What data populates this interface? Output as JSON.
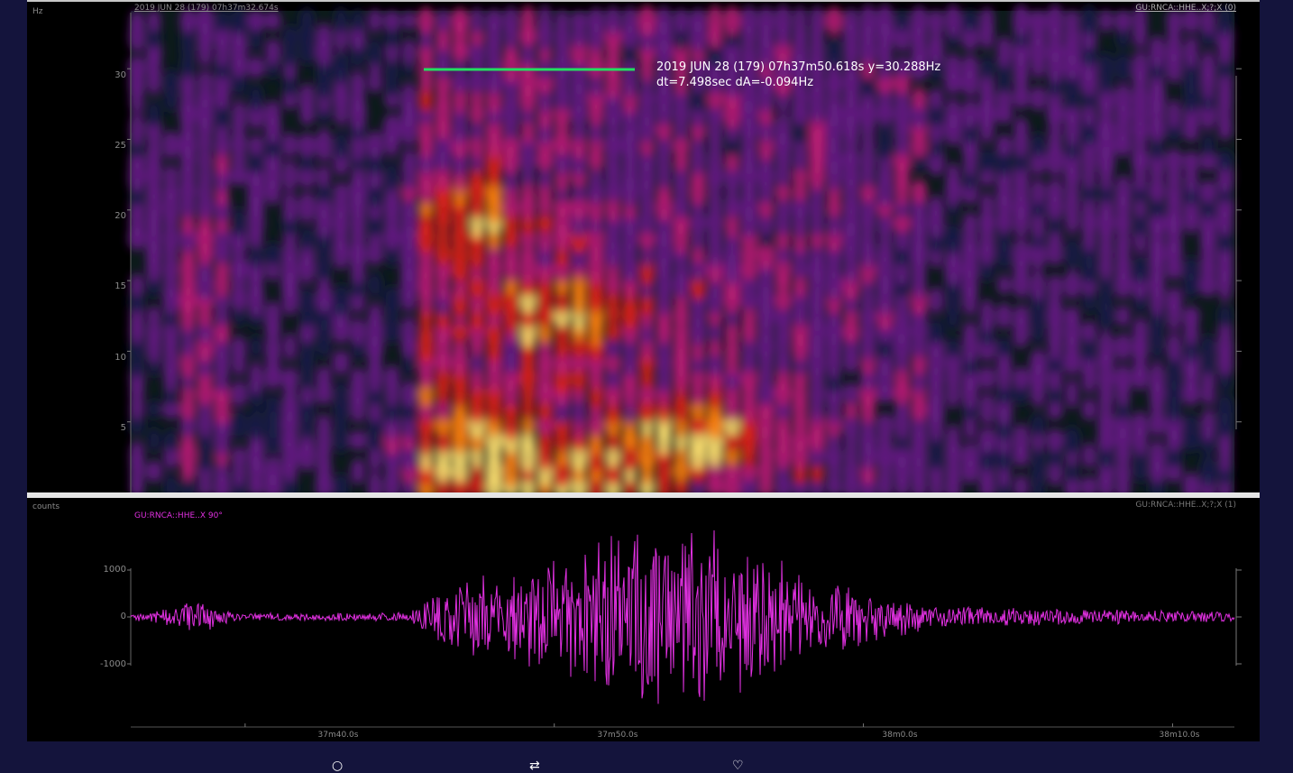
{
  "spectrogram": {
    "y_unit": "Hz",
    "header_time": "2019 JUN 28 (179)  07h37m32.674s",
    "channel_label": "GU:RNCA::HHE..X;?;X (0)",
    "yticks": [
      "30",
      "25",
      "20",
      "15",
      "10",
      "5"
    ],
    "cursor_readout_line1": "2019 JUN 28 (179)  07h37m50.618s  y=30.288Hz",
    "cursor_readout_line2": "dt=7.498sec dA=-0.094Hz",
    "marker_color": "#22e060"
  },
  "waveform": {
    "y_unit": "counts",
    "channel_label": "GU:RNCA::HHE..X;?;X (1)",
    "trace_label": "GU:RNCA::HHE..X 90°",
    "yticks": [
      "1000",
      "0",
      "-1000"
    ],
    "trace_color": "#e030e0"
  },
  "time_axis": {
    "ticks": [
      "37m40.0s",
      "37m50.0s",
      "38m0.0s",
      "38m10.0s"
    ]
  },
  "chart_data": [
    {
      "type": "heatmap",
      "title": "",
      "xlabel": "",
      "ylabel": "Hz",
      "ylim": [
        0,
        33
      ],
      "yticks": [
        5,
        10,
        15,
        20,
        25,
        30
      ],
      "x_range": [
        "37m36.3s",
        "38m12.0s"
      ],
      "colormap": [
        "#000000",
        "#1a1a4a",
        "#6a1a8a",
        "#c01a7a",
        "#e0201a",
        "#ff8010",
        "#ffe070"
      ],
      "hotspots": [
        {
          "t_s": 18.5,
          "f_hz": 4.0,
          "level": 1.0
        },
        {
          "t_s": 15.0,
          "f_hz": 1.0,
          "level": 0.9
        },
        {
          "t_s": 14.0,
          "f_hz": 13.0,
          "level": 0.7
        },
        {
          "t_s": 11.0,
          "f_hz": 19.5,
          "level": 0.6
        },
        {
          "t_s": 11.0,
          "f_hz": 3.0,
          "level": 0.7
        }
      ]
    },
    {
      "type": "line",
      "title": "",
      "xlabel": "",
      "ylabel": "counts",
      "ylim": [
        -2100,
        2100
      ],
      "yticks": [
        -1000,
        0,
        1000
      ],
      "x_range": [
        "37m36.3s",
        "38m12.0s"
      ],
      "xticks": [
        "37m40.0s",
        "37m50.0s",
        "38m0.0s",
        "38m10.0s"
      ],
      "envelope": [
        {
          "t_s": 0.0,
          "amp": 60
        },
        {
          "t_s": 2.2,
          "amp": 350
        },
        {
          "t_s": 3.5,
          "amp": 80
        },
        {
          "t_s": 9.0,
          "amp": 100
        },
        {
          "t_s": 10.5,
          "amp": 800
        },
        {
          "t_s": 13.0,
          "amp": 1100
        },
        {
          "t_s": 16.0,
          "amp": 1900
        },
        {
          "t_s": 18.5,
          "amp": 2100
        },
        {
          "t_s": 22.0,
          "amp": 900
        },
        {
          "t_s": 26.0,
          "amp": 250
        },
        {
          "t_s": 35.7,
          "amp": 100
        }
      ]
    }
  ]
}
